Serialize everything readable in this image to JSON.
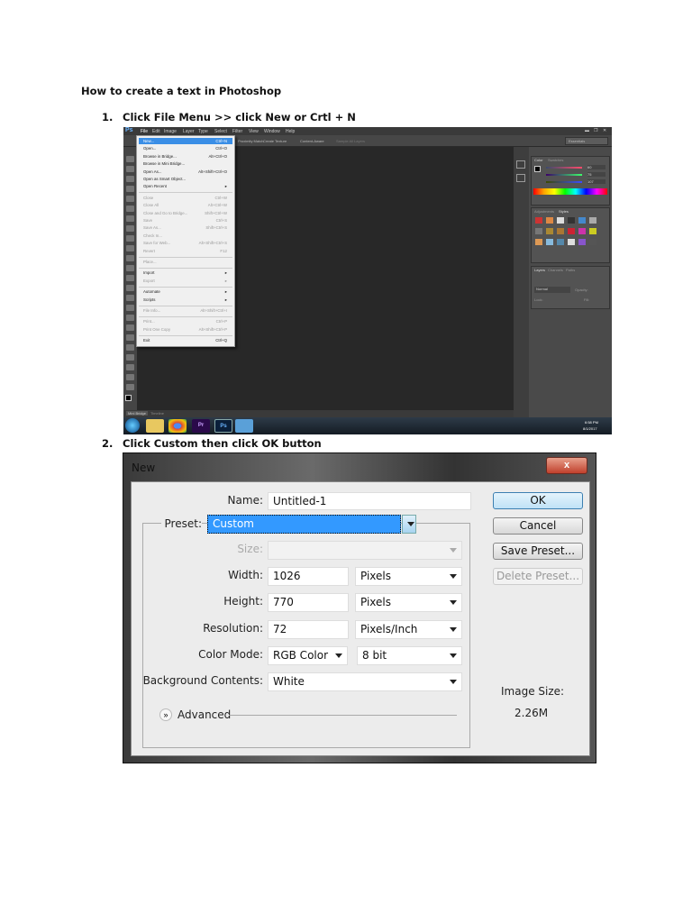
{
  "document": {
    "title": "How to create a text in Photoshop",
    "steps": [
      {
        "number": "1.",
        "text": "Click File Menu >>  click New or Crtl + N"
      },
      {
        "number": "2.",
        "text": "Click Custom then click OK button"
      }
    ]
  },
  "photoshop": {
    "logo": "Ps",
    "menubar": [
      "File",
      "Edit",
      "Image",
      "Layer",
      "Type",
      "Select",
      "Filter",
      "View",
      "Window",
      "Help"
    ],
    "options": [
      "Sample All Layers",
      "Create Texture",
      "Content-Aware",
      "Proximity Match"
    ],
    "workspace": "Essentials",
    "file_menu": [
      {
        "label": "New...",
        "shortcut": "Ctrl+N",
        "state": "highlighted"
      },
      {
        "label": "Open...",
        "shortcut": "Ctrl+O"
      },
      {
        "label": "Browse in Bridge...",
        "shortcut": "Alt+Ctrl+O"
      },
      {
        "label": "Browse in Mini Bridge...",
        "shortcut": ""
      },
      {
        "label": "Open As...",
        "shortcut": "Alt+Shift+Ctrl+O"
      },
      {
        "label": "Open as Smart Object...",
        "shortcut": ""
      },
      {
        "label": "Open Recent",
        "shortcut": "▸"
      },
      {
        "label": "Close",
        "shortcut": "Ctrl+W",
        "state": "disabled"
      },
      {
        "label": "Close All",
        "shortcut": "Alt+Ctrl+W",
        "state": "disabled"
      },
      {
        "label": "Close and Go to Bridge...",
        "shortcut": "Shift+Ctrl+W",
        "state": "disabled"
      },
      {
        "label": "Save",
        "shortcut": "Ctrl+S",
        "state": "disabled"
      },
      {
        "label": "Save As...",
        "shortcut": "Shift+Ctrl+S",
        "state": "disabled"
      },
      {
        "label": "Check In...",
        "shortcut": "",
        "state": "disabled"
      },
      {
        "label": "Save for Web...",
        "shortcut": "Alt+Shift+Ctrl+S",
        "state": "disabled"
      },
      {
        "label": "Revert",
        "shortcut": "F12",
        "state": "disabled"
      },
      {
        "label": "Place...",
        "shortcut": "",
        "state": "disabled"
      },
      {
        "label": "Import",
        "shortcut": "▸"
      },
      {
        "label": "Export",
        "shortcut": "▸",
        "state": "disabled"
      },
      {
        "label": "Automate",
        "shortcut": "▸"
      },
      {
        "label": "Scripts",
        "shortcut": "▸"
      },
      {
        "label": "File Info...",
        "shortcut": "Alt+Shift+Ctrl+I",
        "state": "disabled"
      },
      {
        "label": "Print...",
        "shortcut": "Ctrl+P",
        "state": "disabled"
      },
      {
        "label": "Print One Copy",
        "shortcut": "Alt+Shift+Ctrl+P",
        "state": "disabled"
      },
      {
        "label": "Exit",
        "shortcut": "Ctrl+Q"
      }
    ],
    "panels": {
      "color_tabs": [
        "Color",
        "Swatches"
      ],
      "styles_tabs": [
        "Adjustments",
        "Styles"
      ],
      "layers_tabs": [
        "Layers",
        "Channels",
        "Paths"
      ],
      "blend_mode": "Normal",
      "opacity_label": "Opacity:",
      "lock_label": "Lock:",
      "fill_label": "Fill:",
      "rgb": [
        "60",
        "75",
        "107"
      ]
    },
    "bottom_tabs": [
      "Mini Bridge",
      "Timeline"
    ],
    "taskbar": {
      "apps": [
        "Pr",
        "Ps"
      ],
      "time": "6:58 PM",
      "date": "8/1/2017"
    }
  },
  "dialog": {
    "title": "New",
    "close": "x",
    "name_label": "Name:",
    "name_value": "Untitled-1",
    "preset_label": "Preset:",
    "preset_value": "Custom",
    "size_label": "Size:",
    "width_label": "Width:",
    "width_value": "1026",
    "width_unit": "Pixels",
    "height_label": "Height:",
    "height_value": "770",
    "height_unit": "Pixels",
    "resolution_label": "Resolution:",
    "resolution_value": "72",
    "resolution_unit": "Pixels/Inch",
    "color_mode_label": "Color Mode:",
    "color_mode_value": "RGB Color",
    "bit_depth": "8 bit",
    "background_label": "Background Contents:",
    "background_value": "White",
    "advanced_label": "Advanced",
    "ok": "OK",
    "cancel": "Cancel",
    "save_preset": "Save Preset...",
    "delete_preset": "Delete Preset...",
    "image_size_label": "Image Size:",
    "image_size_value": "2.26M"
  }
}
